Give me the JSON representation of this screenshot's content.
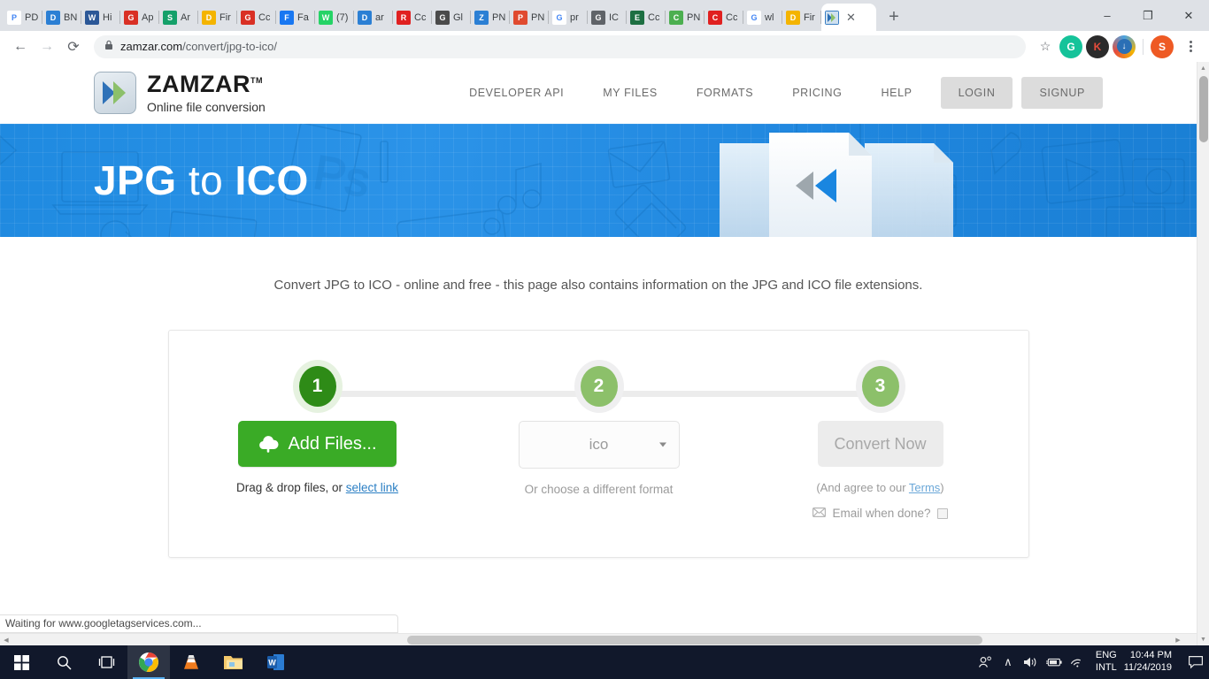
{
  "browser": {
    "tabs": [
      {
        "label": "PD",
        "favicon": "pdf-icon",
        "color": "#ffffff"
      },
      {
        "label": "BN",
        "favicon": "doc-icon",
        "color": "#2b7fd4"
      },
      {
        "label": "Hi",
        "favicon": "word-icon",
        "color": "#2b5797"
      },
      {
        "label": "Ap",
        "favicon": "gmail-icon",
        "color": "#d93025"
      },
      {
        "label": "Ar",
        "favicon": "spinner-icon",
        "color": "#14a06a"
      },
      {
        "label": "Fir",
        "favicon": "drive-icon",
        "color": "#f4b400"
      },
      {
        "label": "Cc",
        "favicon": "gmail-icon",
        "color": "#d93025"
      },
      {
        "label": "Fa",
        "favicon": "facebook-icon",
        "color": "#1877f2"
      },
      {
        "label": "(7)",
        "favicon": "whatsapp-icon",
        "color": "#25d366"
      },
      {
        "label": "ar",
        "favicon": "doc-icon",
        "color": "#2b7fd4"
      },
      {
        "label": "Cc",
        "favicon": "refresh-icon",
        "color": "#e02020"
      },
      {
        "label": "Gl",
        "favicon": "grid-icon",
        "color": "#4a4a4a"
      },
      {
        "label": "PN",
        "favicon": "zamzar-icon",
        "color": "#2b7fd4"
      },
      {
        "label": "PN",
        "favicon": "pngjpg-icon",
        "color": "#e04a2f"
      },
      {
        "label": "pr",
        "favicon": "google-icon",
        "color": "#ffffff"
      },
      {
        "label": "IC",
        "favicon": "globe-icon",
        "color": "#5f6368"
      },
      {
        "label": "Cc",
        "favicon": "excel-icon",
        "color": "#1d6f42"
      },
      {
        "label": "PN",
        "favicon": "convert-icon",
        "color": "#4caf50"
      },
      {
        "label": "Cc",
        "favicon": "ci-icon",
        "color": "#e02020"
      },
      {
        "label": "wl",
        "favicon": "google-icon",
        "color": "#ffffff"
      },
      {
        "label": "Fir",
        "favicon": "drive-icon",
        "color": "#f4b400"
      }
    ],
    "active_tab": {
      "label": "",
      "favicon": "zamzar-icon",
      "close": "✕"
    },
    "new_tab_label": "+",
    "window_controls": {
      "minimize": "‒",
      "maximize": "❐",
      "close": "✕"
    },
    "toolbar": {
      "back": "←",
      "forward": "→",
      "reload": "⟳",
      "lock_icon": "🔒",
      "url_domain": "zamzar.com",
      "url_path": "/convert/jpg-to-ico/",
      "bookmark_star": "☆",
      "extensions": [
        {
          "name": "grammarly-extension",
          "letter": "G",
          "color": "#15c39a"
        },
        {
          "name": "kami-extension",
          "letter": "K",
          "color": "#2b2b2b"
        },
        {
          "name": "downloader-extension",
          "letter": "↓",
          "color": "#3a9ad9"
        }
      ],
      "profile": {
        "letter": "S",
        "color": "#ee5a24"
      },
      "menu": "⋮"
    },
    "status_text": "Waiting for www.googletagservices.com..."
  },
  "site": {
    "logo": {
      "name": "ZAMZAR",
      "trademark": "TM",
      "tagline": "Online file conversion"
    },
    "nav": [
      {
        "label": "DEVELOPER API"
      },
      {
        "label": "MY FILES"
      },
      {
        "label": "FORMATS"
      },
      {
        "label": "PRICING"
      },
      {
        "label": "HELP"
      }
    ],
    "buttons": {
      "login": "LOGIN",
      "signup": "SIGNUP"
    },
    "hero": {
      "title_from": "JPG",
      "title_mid": "to",
      "title_to": "ICO"
    },
    "subtitle": "Convert JPG to ICO - online and free - this page also contains information on the JPG and ICO file extensions.",
    "converter": {
      "steps": [
        {
          "number": "1",
          "state": "active"
        },
        {
          "number": "2",
          "state": "pending"
        },
        {
          "number": "3",
          "state": "pending"
        }
      ],
      "step1": {
        "button_label": "Add Files...",
        "icon": "cloud-upload-icon",
        "hint_prefix": "Drag & drop files, or ",
        "hint_link": "select link"
      },
      "step2": {
        "selected_format": "ico",
        "caret": "▾",
        "hint": "Or choose a different format"
      },
      "step3": {
        "button_label": "Convert Now",
        "terms_prefix": "(And agree to our ",
        "terms_link": "Terms",
        "terms_suffix": ")",
        "email_icon": "envelope-icon",
        "email_label": "Email when done?",
        "email_checked": false
      }
    }
  },
  "taskbar": {
    "apps": [
      {
        "name": "start-button",
        "icon": "windows-icon"
      },
      {
        "name": "search-button",
        "icon": "search-icon"
      },
      {
        "name": "task-view-button",
        "icon": "task-view-icon"
      },
      {
        "name": "chrome-taskbar-icon",
        "icon": "chrome-icon",
        "active": true
      },
      {
        "name": "vlc-taskbar-icon",
        "icon": "vlc-icon"
      },
      {
        "name": "file-explorer-taskbar-icon",
        "icon": "folder-icon"
      },
      {
        "name": "word-taskbar-icon",
        "icon": "word-icon"
      }
    ],
    "tray": {
      "people_icon": "people-icon",
      "chevron": "∧",
      "volume_icon": "speaker-icon",
      "battery_icon": "battery-icon",
      "wifi_icon": "wifi-icon",
      "lang_line1": "ENG",
      "lang_line2": "INTL",
      "time": "10:44 PM",
      "date": "11/24/2019",
      "notification_icon": "notification-icon"
    }
  }
}
